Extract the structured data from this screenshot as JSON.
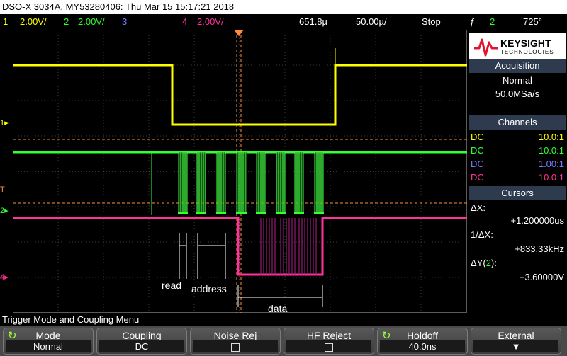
{
  "window": {
    "title": "DSO-X 3034A, MY53280406: Thu Mar 15 15:17:21 2018"
  },
  "status": {
    "ch1": {
      "num": "1",
      "scale": "2.00V/",
      "color": "#ffff00"
    },
    "ch2": {
      "num": "2",
      "scale": "2.00V/",
      "color": "#33ff33"
    },
    "ch3": {
      "num": "3",
      "color": "#7a7aff"
    },
    "ch4": {
      "num": "4",
      "scale": "2.00V/",
      "color": "#ff3399"
    },
    "delay": "651.8µ",
    "timebase": "50.00µ/",
    "run_state": "Stop",
    "trigger_symbol": "ƒ",
    "trigger_source": "2",
    "trigger_level": "725°"
  },
  "brand": {
    "name": "KEYSIGHT",
    "sub": "TECHNOLOGIES"
  },
  "acquisition": {
    "header": "Acquisition",
    "mode": "Normal",
    "rate": "50.0MSa/s"
  },
  "channels": {
    "header": "Channels",
    "rows": [
      {
        "coupling": "DC",
        "probe": "10.0:1",
        "color": "#ffff00"
      },
      {
        "coupling": "DC",
        "probe": "10.0:1",
        "color": "#33ff33"
      },
      {
        "coupling": "DC",
        "probe": "1.00:1",
        "color": "#7a7aff"
      },
      {
        "coupling": "DC",
        "probe": "10.0:1",
        "color": "#ff3399"
      }
    ]
  },
  "cursors": {
    "header": "Cursors",
    "dx_label": "ΔX:",
    "dx_value": "+1.200000us",
    "inv_label": "1/ΔX:",
    "inv_value": "+833.33kHz",
    "dy_label": "ΔY(",
    "dy_ch": "2",
    "dy_close": "):",
    "dy_value": "+3.60000V"
  },
  "annotations": {
    "read": "read",
    "address": "address",
    "data": "data"
  },
  "markers": {
    "ch1": "1",
    "ch2": "2",
    "ch4": "4",
    "trigger": "T"
  },
  "menu": {
    "title": "Trigger Mode and Coupling Menu"
  },
  "softkeys": [
    {
      "label": "Mode",
      "value": "Normal"
    },
    {
      "label": "Coupling",
      "value": "DC"
    },
    {
      "label": "Noise Rej",
      "value": ""
    },
    {
      "label": "HF Reject",
      "value": ""
    },
    {
      "label": "Holdoff",
      "value": "40.0ns"
    },
    {
      "label": "External",
      "value": ""
    }
  ]
}
